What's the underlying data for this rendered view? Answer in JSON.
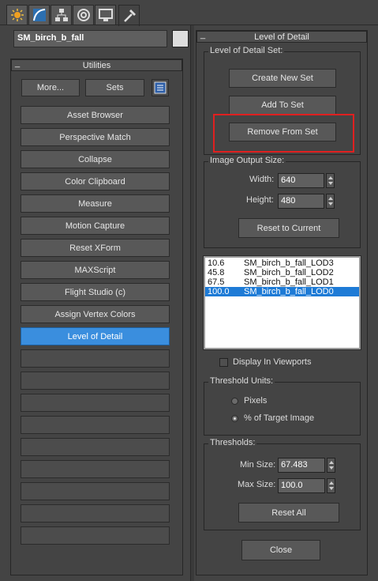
{
  "tabs": [
    {
      "icon": "create-icon"
    },
    {
      "icon": "modify-icon"
    },
    {
      "icon": "hierarchy-icon"
    },
    {
      "icon": "motion-icon"
    },
    {
      "icon": "display-icon"
    },
    {
      "icon": "utilities-hammer-icon"
    }
  ],
  "object_name": "SM_birch_b_fall",
  "utilities": {
    "title": "Utilities",
    "more_label": "More...",
    "sets_label": "Sets",
    "items": [
      "Asset Browser",
      "Perspective Match",
      "Collapse",
      "Color Clipboard",
      "Measure",
      "Motion Capture",
      "Reset XForm",
      "MAXScript",
      "Flight Studio (c)",
      "Assign Vertex Colors",
      "Level of Detail",
      "",
      "",
      "",
      "",
      "",
      "",
      "",
      "",
      ""
    ],
    "selected_index": 10
  },
  "lod": {
    "title": "Level of Detail",
    "set_group": "Level of Detail Set:",
    "create_label": "Create New Set",
    "add_label": "Add To Set",
    "remove_label": "Remove From Set",
    "output_group": "Image Output Size:",
    "width_label": "Width:",
    "width_value": "640",
    "height_label": "Height:",
    "height_value": "480",
    "reset_current_label": "Reset to Current",
    "list": [
      {
        "value": "10.6",
        "name": "SM_birch_b_fall_LOD3"
      },
      {
        "value": "45.8",
        "name": "SM_birch_b_fall_LOD2"
      },
      {
        "value": "67.5",
        "name": "SM_birch_b_fall_LOD1"
      },
      {
        "value": "100.0",
        "name": "SM_birch_b_fall_LOD0"
      }
    ],
    "selected_row": 3,
    "display_viewports_label": "Display In Viewports",
    "units_group": "Threshold Units:",
    "pixels_label": "Pixels",
    "percent_label": "% of Target Image",
    "thresholds_group": "Thresholds:",
    "min_label": "Min Size:",
    "min_value": "67.483",
    "max_label": "Max Size:",
    "max_value": "100.0",
    "reset_all_label": "Reset All",
    "close_label": "Close"
  }
}
